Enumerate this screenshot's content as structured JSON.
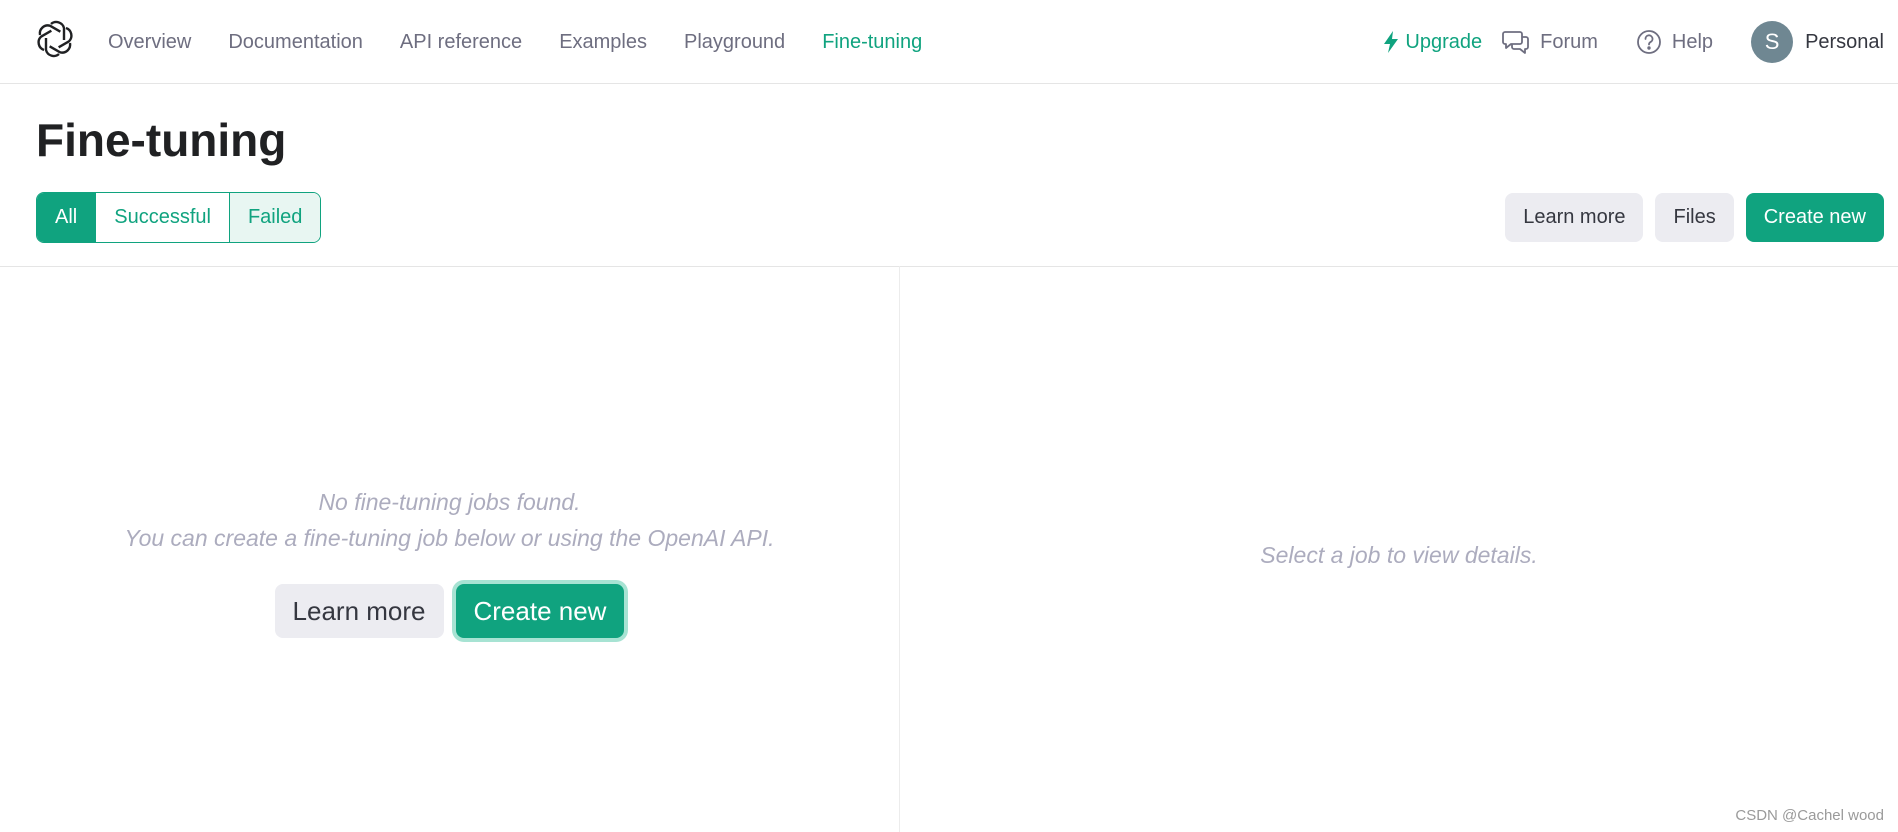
{
  "nav": {
    "links": [
      "Overview",
      "Documentation",
      "API reference",
      "Examples",
      "Playground",
      "Fine-tuning"
    ],
    "active_link": "Fine-tuning",
    "upgrade": "Upgrade",
    "forum": "Forum",
    "help": "Help",
    "avatar_initial": "S",
    "account": "Personal"
  },
  "header": {
    "title": "Fine-tuning",
    "filters": [
      {
        "label": "All",
        "state": "active"
      },
      {
        "label": "Successful",
        "state": "default"
      },
      {
        "label": "Failed",
        "state": "hover"
      }
    ],
    "actions": {
      "learn_more": "Learn more",
      "files": "Files",
      "create_new": "Create new"
    }
  },
  "jobs_panel": {
    "empty_line_1": "No fine-tuning jobs found.",
    "empty_line_2": "You can create a fine-tuning job below or using the OpenAI API.",
    "learn_more": "Learn more",
    "create_new": "Create new"
  },
  "details_panel": {
    "empty_text": "Select a job to view details."
  },
  "watermark": "CSDN @Cachel wood",
  "colors": {
    "accent": "#10a37f",
    "muted_text": "#acacbe",
    "nav_text": "#6e6e80",
    "button_gray": "#ececf1"
  },
  "icons": {
    "logo": "openai-logo-icon",
    "upgrade": "lightning-icon",
    "forum": "chat-bubbles-icon",
    "help": "question-circle-icon"
  }
}
